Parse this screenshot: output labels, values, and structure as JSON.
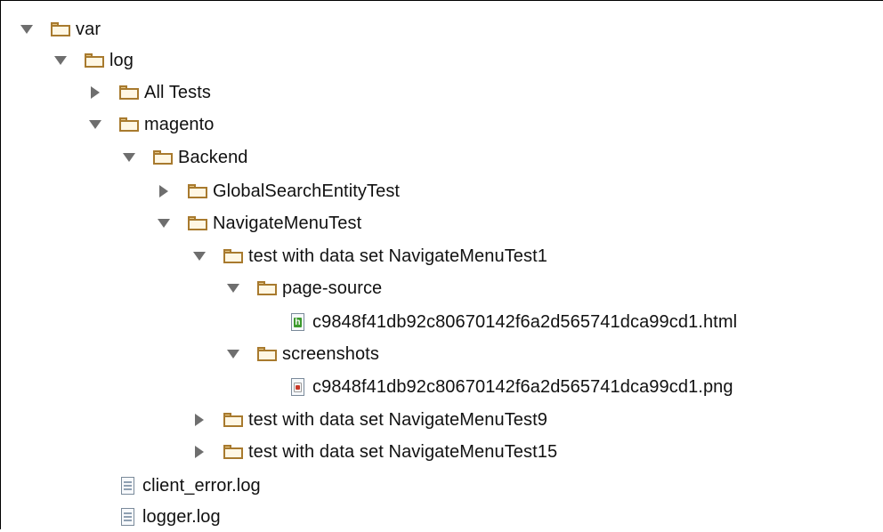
{
  "tree": {
    "nodes": [
      {
        "label": "var",
        "kind": "folder",
        "expanded": true,
        "level": 0
      },
      {
        "label": "log",
        "kind": "folder",
        "expanded": true,
        "level": 1
      },
      {
        "label": "All Tests",
        "kind": "folder",
        "expanded": false,
        "level": 2
      },
      {
        "label": "magento",
        "kind": "folder",
        "expanded": true,
        "level": 2
      },
      {
        "label": "Backend",
        "kind": "folder",
        "expanded": true,
        "level": 3
      },
      {
        "label": "GlobalSearchEntityTest",
        "kind": "folder",
        "expanded": false,
        "level": 4
      },
      {
        "label": "NavigateMenuTest",
        "kind": "folder",
        "expanded": true,
        "level": 4
      },
      {
        "label": "test with data set NavigateMenuTest1",
        "kind": "folder",
        "expanded": true,
        "level": 5
      },
      {
        "label": "page-source",
        "kind": "folder",
        "expanded": true,
        "level": 6
      },
      {
        "label": "c9848f41db92c80670142f6a2d565741dca99cd1.html",
        "kind": "html-file",
        "level": 7
      },
      {
        "label": "screenshots",
        "kind": "folder",
        "expanded": true,
        "level": 6
      },
      {
        "label": "c9848f41db92c80670142f6a2d565741dca99cd1.png",
        "kind": "png-file",
        "level": 7
      },
      {
        "label": "test with data set NavigateMenuTest9",
        "kind": "folder",
        "expanded": false,
        "level": 5
      },
      {
        "label": "test with data set NavigateMenuTest15",
        "kind": "folder",
        "expanded": false,
        "level": 5
      },
      {
        "label": "client_error.log",
        "kind": "text-file",
        "level": 2
      },
      {
        "label": "logger.log",
        "kind": "text-file",
        "level": 2
      }
    ]
  },
  "icons": {
    "folder": "folder-icon",
    "html_file": "html-file-icon",
    "png_file": "image-file-icon",
    "text_file": "text-file-icon",
    "expanded": "expanded-arrow-icon",
    "collapsed": "collapsed-arrow-icon"
  },
  "colors": {
    "folder_outline": "#a87a2e",
    "folder_fill": "#fff7e4",
    "arrow": "#6e6e6e",
    "html_badge": "#3d9a2e",
    "png_badge": "#c83a2b"
  }
}
